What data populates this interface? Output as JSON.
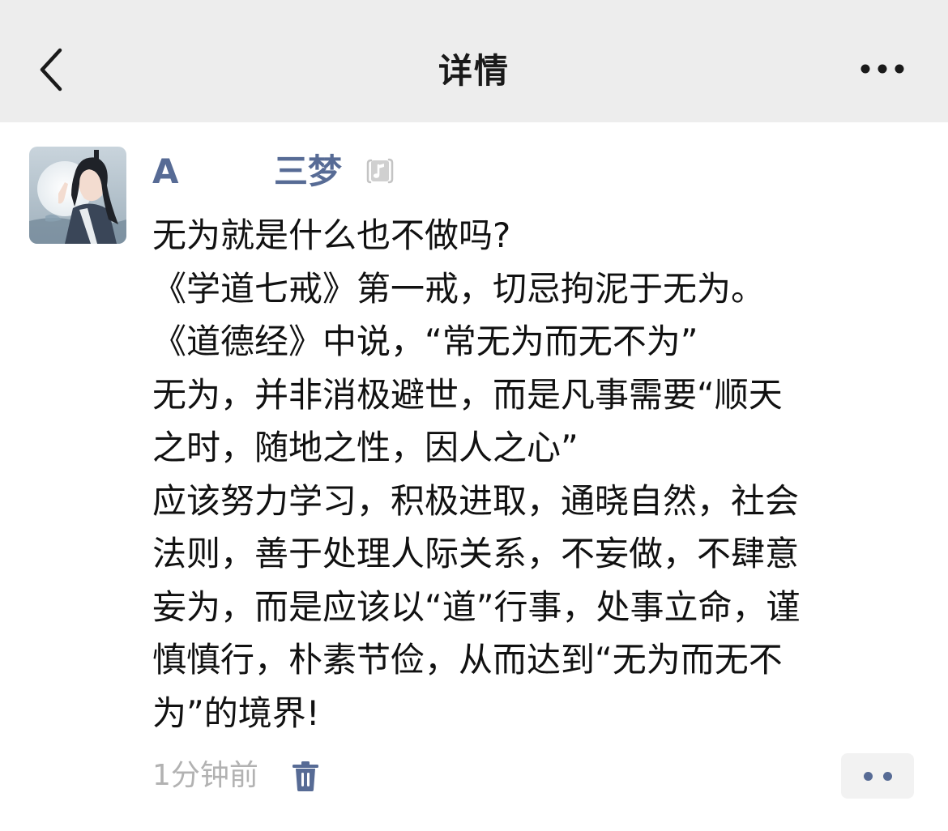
{
  "header": {
    "title": "详情",
    "back_icon": "chevron-left-icon",
    "more_icon": "more-dots-icon"
  },
  "post": {
    "author_names": [
      "A",
      "三梦"
    ],
    "author_badge_icon": "music-note-icon",
    "lines": [
      "无为就是什么也不做吗?",
      "《学道七戒》第一戒，切忌拘泥于无为。",
      "《道德经》中说，“常无为而无不为”",
      "无为，并非消极避世，而是凡事需要“顺天",
      "之时，随地之性，因人之心”",
      "应该努力学习，积极进取，通晓自然，社会",
      "法则，善于处理人际关系，不妄做，不肆意",
      "妄为，而是应该以“道”行事，处事立命，谨",
      "慎慎行，朴素节俭，从而达到“无为而无不",
      "为”的境界!"
    ]
  },
  "footer": {
    "time": "1分钟前",
    "delete_icon": "trash-icon",
    "action_icon": "two-dots-icon"
  },
  "colors": {
    "topbar_bg": "#ededed",
    "name_color": "#576b95",
    "text_color": "#111111",
    "time_color": "#b2b2b2",
    "action_bg": "#f2f2f2"
  }
}
